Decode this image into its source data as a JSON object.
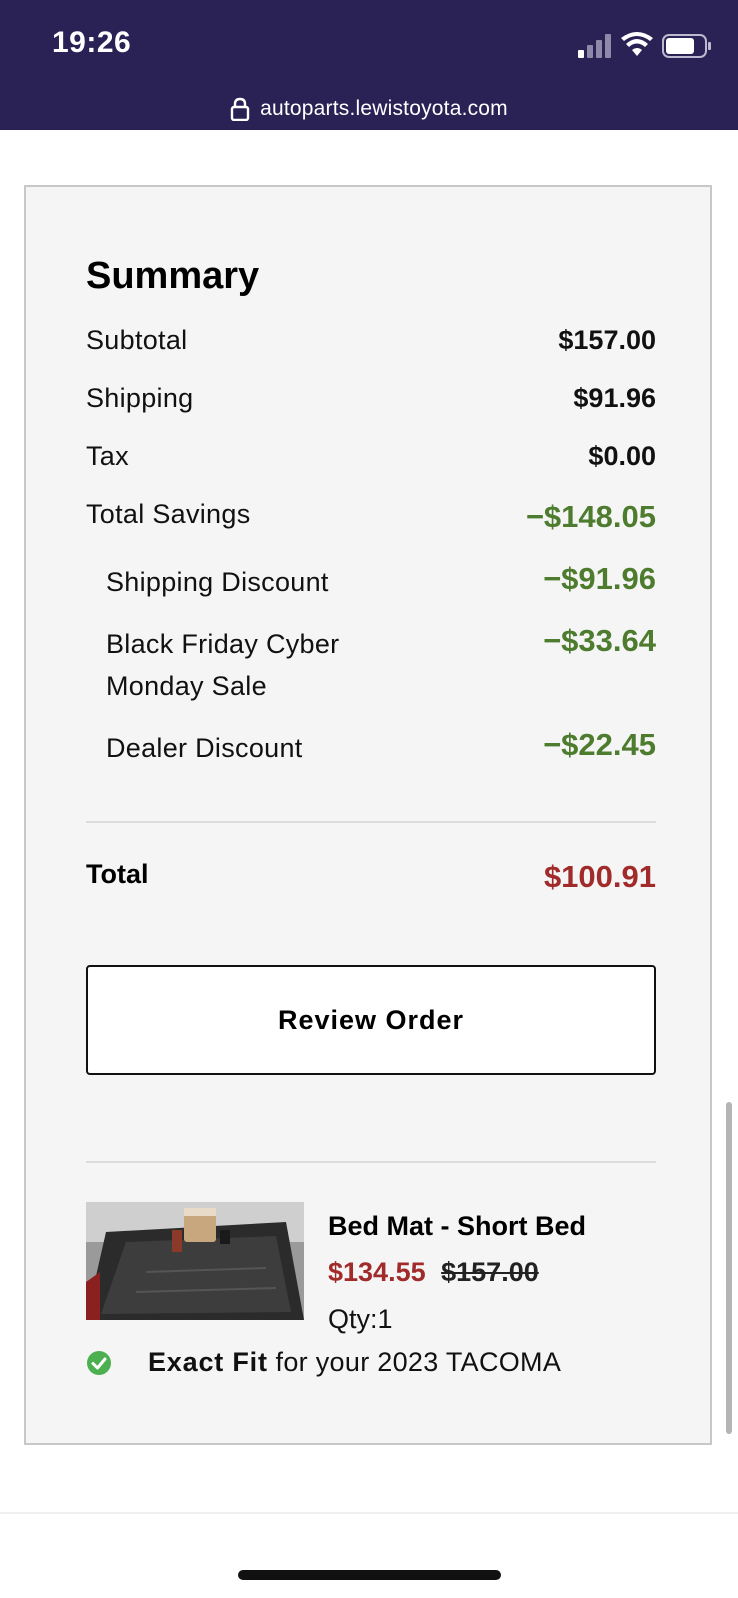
{
  "status_bar": {
    "time": "19:26",
    "url": "autoparts.lewistoyota.com",
    "icons": [
      "signal-icon",
      "wifi-icon",
      "battery-icon",
      "lock-icon"
    ]
  },
  "summary": {
    "title": "Summary",
    "subtotal_label": "Subtotal",
    "subtotal_value": "$157.00",
    "shipping_label": "Shipping",
    "shipping_value": "$91.96",
    "tax_label": "Tax",
    "tax_value": "$0.00",
    "savings_label": "Total Savings",
    "savings_value": "−$148.05",
    "discounts": [
      {
        "label": "Shipping Discount",
        "value": "−$91.96"
      },
      {
        "label": "Black Friday Cyber Monday Sale",
        "value": "−$33.64"
      },
      {
        "label": "Dealer Discount",
        "value": "−$22.45"
      }
    ],
    "total_label": "Total",
    "total_value": "$100.91",
    "review_button": "Review Order"
  },
  "item": {
    "name": "Bed Mat - Short Bed",
    "sale_price": "$134.55",
    "original_price": "$157.00",
    "qty": "Qty:1",
    "fit_strong": "Exact Fit",
    "fit_rest": " for your 2023 TACOMA"
  },
  "colors": {
    "status_bar_bg": "#2a2255",
    "savings_green": "#4e7c2f",
    "price_red": "#a12a2a",
    "check_green": "#4caf50"
  }
}
